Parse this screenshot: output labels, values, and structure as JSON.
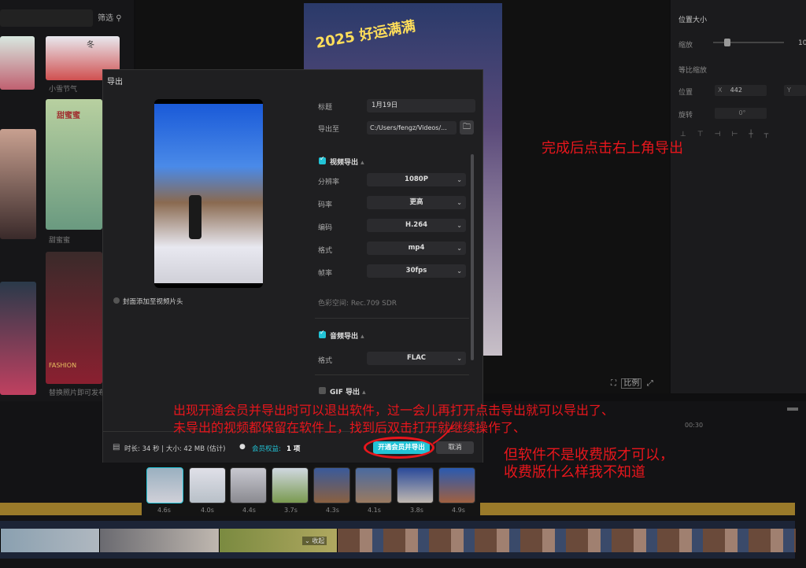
{
  "left_panel": {
    "filter_label": "筛选",
    "items": [
      {
        "label": "小雪节气",
        "thumb_text": "冬"
      },
      {
        "label": "甜蜜蜜",
        "thumb_text": "甜蜜蜜"
      },
      {
        "label": "替换照片即可发布",
        "thumb_text": "FASHION"
      }
    ]
  },
  "preview": {
    "banner_text": "2025 好运满满",
    "tools": [
      "⛶",
      "比例",
      "⤢"
    ]
  },
  "properties": {
    "section_title": "位置大小",
    "scale_label": "缩放",
    "scale_value": "10",
    "ratio_label": "等比缩放",
    "position_label": "位置",
    "x_label": "X",
    "x_value": "442",
    "y_label": "Y",
    "rotate_label": "旋转",
    "rotate_value": "0°"
  },
  "dialog": {
    "title": "导出",
    "cover_checkbox_label": "封面添加至视频片头",
    "fields": {
      "title_label": "标题",
      "title_value": "1月19日",
      "export_to_label": "导出至",
      "export_to_value": "C:/Users/fengz/Videos/..."
    },
    "video_section": {
      "label": "视频导出",
      "rows": [
        {
          "label": "分辨率",
          "value": "1080P"
        },
        {
          "label": "码率",
          "value": "更高"
        },
        {
          "label": "编码",
          "value": "H.264"
        },
        {
          "label": "格式",
          "value": "mp4"
        },
        {
          "label": "帧率",
          "value": "30fps"
        }
      ],
      "color_space": "色彩空间: Rec.709 SDR"
    },
    "audio_section": {
      "label": "音频导出",
      "rows": [
        {
          "label": "格式",
          "value": "FLAC"
        }
      ]
    },
    "gif_section": {
      "label": "GIF 导出"
    },
    "footer": {
      "duration_info": "时长: 34 秒 | 大小: 42 MB (估计)",
      "member_label": "会员权益:",
      "member_value": "1 项",
      "primary_button": "开通会员并导出",
      "cancel_button": "取消"
    }
  },
  "annotations": {
    "top_right": "完成后点击右上角导出",
    "middle_line1": "出现开通会员并导出时可以退出软件，过一会儿再打开点击导出就可以导出了、",
    "middle_line2": "未导出的视频都保留在软件上，找到后双击打开就继续操作了、",
    "bottom_line1": "但软件不是收费版才可以，",
    "bottom_line2": "收费版什么样我不知道"
  },
  "timeline": {
    "time_marker": "00:30",
    "collapse_label": "收起"
  },
  "filmstrip": {
    "durations": [
      "4.6s",
      "4.0s",
      "4.4s",
      "3.7s",
      "4.3s",
      "4.1s",
      "3.8s",
      "4.9s"
    ]
  },
  "colors": {
    "accent": "#22c3d6",
    "annotation": "#e8161c"
  }
}
